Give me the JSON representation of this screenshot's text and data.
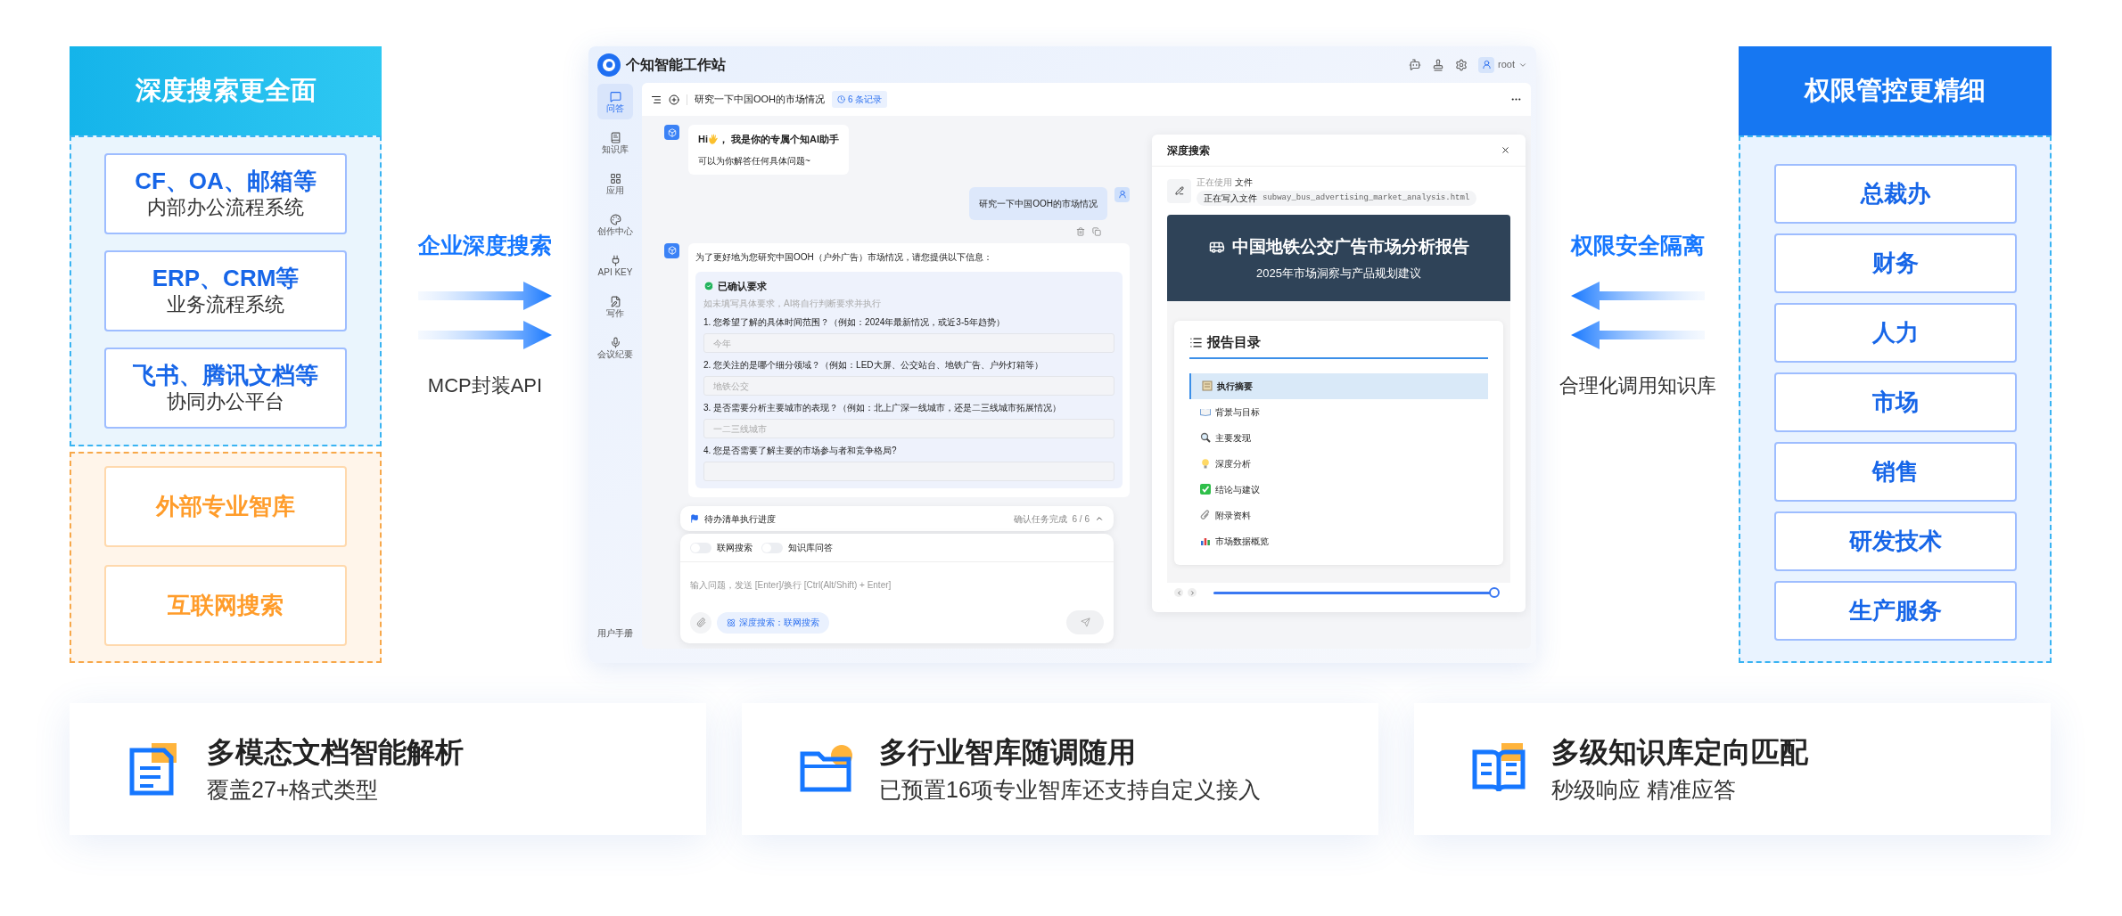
{
  "left_panel": {
    "title": "深度搜索更全面",
    "internal": [
      {
        "title": "CF、OA、邮箱等",
        "subtitle": "内部办公流程系统"
      },
      {
        "title": "ERP、CRM等",
        "subtitle": "业务流程系统"
      },
      {
        "title": "飞书、腾讯文档等",
        "subtitle": "协同办公平台"
      }
    ],
    "external": [
      {
        "title": "外部专业智库"
      },
      {
        "title": "互联网搜索"
      }
    ]
  },
  "left_link": {
    "title": "企业深度搜索",
    "caption": "MCP封装API"
  },
  "app": {
    "title": "个知智能工作站",
    "user": "root",
    "nav": [
      {
        "label": "问答",
        "selected": true
      },
      {
        "label": "知识库",
        "selected": false
      },
      {
        "label": "应用",
        "selected": false
      },
      {
        "label": "创作中心",
        "selected": false
      },
      {
        "label": "API KEY",
        "selected": false
      },
      {
        "label": "写作",
        "selected": false
      },
      {
        "label": "会议纪要",
        "selected": false
      }
    ],
    "nav_footer": "用户手册",
    "conversation": {
      "title": "研究一下中国OOH的市场情况",
      "records": "6 条记录"
    },
    "greeting": {
      "hi": "Hi",
      "title": "， 我是你的专属个知AI助手",
      "subtitle": "可以为你解答任何具体问题~"
    },
    "user_message": "研究一下中国OOH的市场情况",
    "reply": {
      "intro": "为了更好地为您研究中国OOH（户外广告）市场情况，请您提供以下信息：",
      "card_title": "已确认要求",
      "hint": "如未填写具体要求，AI将自行判断要求并执行",
      "questions": [
        {
          "text": "1. 您希望了解的具体时间范围？（例如：2024年最新情况，或近3-5年趋势）",
          "answer": "今年"
        },
        {
          "text": "2. 您关注的是哪个细分领域？（例如：LED大屏、公交站台、地铁广告、户外灯箱等）",
          "answer": "地铁公交"
        },
        {
          "text": "3. 是否需要分析主要城市的表现？（例如：北上广深一线城市，还是二三线城市拓展情况）",
          "answer": "一二三线城市"
        },
        {
          "text": "4. 您是否需要了解主要的市场参与者和竞争格局?"
        }
      ]
    },
    "todo": {
      "title": "待办清单执行进度",
      "status": "确认任务完成",
      "count": "6 / 6",
      "expanded": false
    },
    "toggles": [
      {
        "label": "联网搜索",
        "on": false
      },
      {
        "label": "知识库问答",
        "on": false
      }
    ],
    "input": {
      "placeholder": "输入问题，发送 [Enter]/换行 [Ctrl(Alt/Shift) + Enter]"
    },
    "mode_chip": "深度搜索：联网搜索",
    "deep_search": {
      "title": "深度搜索",
      "tool_label": "正在使用",
      "tool_name": "文件",
      "action": "正在写入文件",
      "filename": "subway_bus_advertising_market_analysis.html",
      "report": {
        "title": "中国地铁公交广告市场分析报告",
        "subtitle": "2025年市场洞察与产品规划建议",
        "toc_title": "报告目录",
        "toc": [
          {
            "label": "执行摘要",
            "kind": "memo",
            "selected": true
          },
          {
            "label": "背景与目标",
            "kind": "book",
            "selected": false
          },
          {
            "label": "主要发现",
            "kind": "search",
            "selected": false
          },
          {
            "label": "深度分析",
            "kind": "bulb",
            "selected": false
          },
          {
            "label": "结论与建议",
            "kind": "check",
            "selected": false
          },
          {
            "label": "附录资料",
            "kind": "clip",
            "selected": false
          },
          {
            "label": "市场数据概览",
            "kind": "chart",
            "selected": false
          }
        ]
      },
      "progress": {
        "level": 1
      }
    }
  },
  "right_link": {
    "title": "权限安全隔离",
    "caption": "合理化调用知识库"
  },
  "right_panel": {
    "title": "权限管控更精细",
    "items": [
      "总裁办",
      "财务",
      "人力",
      "市场",
      "销售",
      "研发技术",
      "生产服务"
    ]
  },
  "features": [
    {
      "kind": "document",
      "title": "多模态文档智能解析",
      "subtitle": "覆盖27+格式类型"
    },
    {
      "kind": "folder",
      "title": "多行业智库随调随用",
      "subtitle": "已预置16项专业智库还支持自定义接入"
    },
    {
      "kind": "book",
      "title": "多级知识库定向匹配",
      "subtitle": "秒级响应 精准应答"
    }
  ]
}
